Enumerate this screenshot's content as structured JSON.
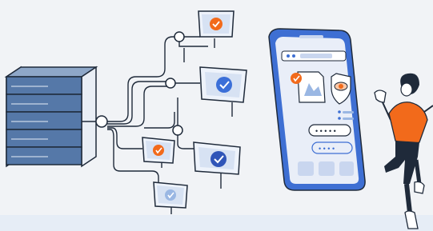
{
  "illustration": {
    "colors": {
      "background": "#f1f3f6",
      "floor": "#e6edf6",
      "server_front": "#5578a8",
      "server_top": "#8ea7c8",
      "server_side": "#e9eef5",
      "outline": "#1f2a3a",
      "node_fill": "#ffffff",
      "card_face": "#eef3fb",
      "check_blue": "#3b6fd8",
      "check_orange": "#f26a1b",
      "phone_frame": "#3e6fd3",
      "phone_screen": "#e9eef8",
      "shirt": "#f26a1b"
    },
    "icons": [
      "server-rack-icon",
      "check-badge-icon",
      "eye-icon",
      "lock-icon",
      "person-icon"
    ],
    "password_mask_1": "• • • • •",
    "password_mask_2": "• • • •"
  }
}
